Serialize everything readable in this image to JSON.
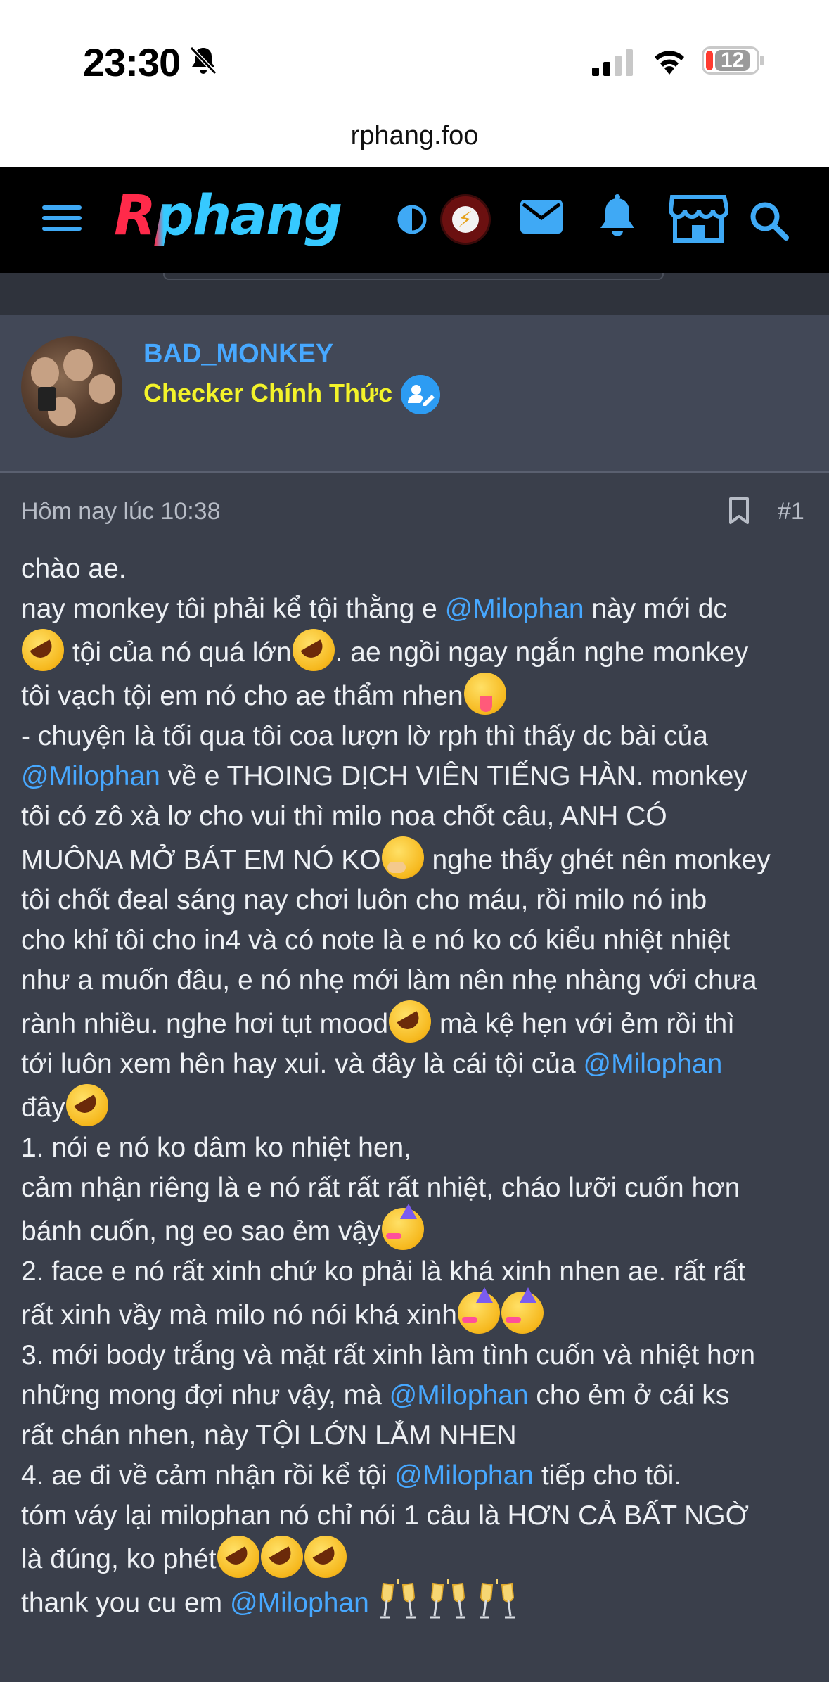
{
  "status_bar": {
    "time": "23:30",
    "battery": "12"
  },
  "browser": {
    "url": "rphang.foo"
  },
  "header": {
    "logo": "Rphang"
  },
  "post": {
    "author": "BAD_MONKEY",
    "user_title": "Checker Chính Thức",
    "date": "Hôm nay lúc 10:38",
    "number": "#1",
    "lines": [
      [
        {
          "t": "chào ae."
        }
      ],
      [
        {
          "t": "nay monkey tôi phải kể tội thằng e "
        },
        {
          "m": "@Milophan"
        },
        {
          "t": " này mới dc"
        }
      ],
      [
        {
          "e": "rofl"
        },
        {
          "t": " tội của nó quá lớn"
        },
        {
          "e": "rofl"
        },
        {
          "t": ". ae ngồi ngay ngắn nghe monkey"
        }
      ],
      [
        {
          "t": "tôi vạch tội em nó cho ae thẩm nhen"
        },
        {
          "e": "tongue"
        }
      ],
      [
        {
          "t": "- chuyện là tối qua tôi coa lượn lờ rph thì thấy dc bài của"
        }
      ],
      [
        {
          "m": "@Milophan"
        },
        {
          "t": " về e THOING DỊCH VIÊN TIẾNG HÀN. monkey"
        }
      ],
      [
        {
          "t": "tôi có zô xà lơ cho vui thì milo noa chốt câu, ANH CÓ"
        }
      ],
      [
        {
          "t": "MUÔNA MỞ BÁT EM NÓ KO"
        },
        {
          "e": "think"
        },
        {
          "t": " nghe thấy ghét nên monkey"
        }
      ],
      [
        {
          "t": "tôi chốt đeal sáng nay chơi luôn cho máu, rồi milo nó inb"
        }
      ],
      [
        {
          "t": "cho khỉ tôi cho in4 và có note là e nó ko có kiểu nhiệt nhiệt"
        }
      ],
      [
        {
          "t": "như a muốn đâu, e nó nhẹ mới làm nên nhẹ nhàng với chưa"
        }
      ],
      [
        {
          "t": "rành nhiều. nghe hơi tụt mood"
        },
        {
          "e": "rofl"
        },
        {
          "t": " mà kệ hẹn với ẻm rồi thì"
        }
      ],
      [
        {
          "t": "tới luôn xem hên hay xui. và đây là cái tội của "
        },
        {
          "m": "@Milophan"
        }
      ],
      [
        {
          "t": "đây"
        },
        {
          "e": "rofl"
        }
      ],
      [
        {
          "t": "1. nói e nó ko dâm ko nhiệt hen,"
        }
      ],
      [
        {
          "t": "cảm nhận riêng là e nó rất rất rất nhiệt, cháo lưỡi cuốn hơn"
        }
      ],
      [
        {
          "t": "bánh cuốn, ng eo sao ẻm vậy"
        },
        {
          "e": "party"
        }
      ],
      [
        {
          "t": "2. face e nó rất xinh chứ ko phải là khá xinh nhen ae. rất rất"
        }
      ],
      [
        {
          "t": "rất xinh vầy mà milo nó nói khá xinh"
        },
        {
          "e": "party"
        },
        {
          "e": "party"
        }
      ],
      [
        {
          "t": "3. mới body trắng và mặt rất xinh làm tình cuốn và nhiệt hơn"
        }
      ],
      [
        {
          "t": "những mong đợi như vậy, mà "
        },
        {
          "m": "@Milophan"
        },
        {
          "t": " cho ẻm ở cái ks"
        }
      ],
      [
        {
          "t": "rất chán nhen, này TỘI LỚN LẮM NHEN"
        }
      ],
      [
        {
          "t": "4. ae đi về cảm nhận rồi kể tội "
        },
        {
          "m": "@Milophan"
        },
        {
          "t": " tiếp cho tôi."
        }
      ],
      [
        {
          "t": "tóm váy lại milophan nó chỉ nói 1 câu là HƠN CẢ BẤT NGỜ"
        }
      ],
      [
        {
          "t": "là đúng, ko phét"
        },
        {
          "e": "rofl"
        },
        {
          "e": "rofl"
        },
        {
          "e": "rofl"
        }
      ],
      [
        {
          "t": "thank you cu em "
        },
        {
          "m": "@Milophan"
        },
        {
          "t": " "
        },
        {
          "e": "cheers"
        },
        {
          "t": " "
        },
        {
          "e": "cheers"
        },
        {
          "t": " "
        },
        {
          "e": "cheers"
        }
      ]
    ]
  },
  "icons": {
    "menu": "hamburger-icon",
    "contrast": "contrast-icon",
    "mail": "mail-icon",
    "bell": "bell-icon",
    "store": "store-icon",
    "search": "search-icon",
    "bookmark": "bookmark-icon",
    "verified": "verified-checker-icon"
  },
  "colors": {
    "accent": "#47a8ff",
    "user_title": "#f3f32a",
    "header_bg": "#000000",
    "post_bg": "#3a3f4b"
  }
}
